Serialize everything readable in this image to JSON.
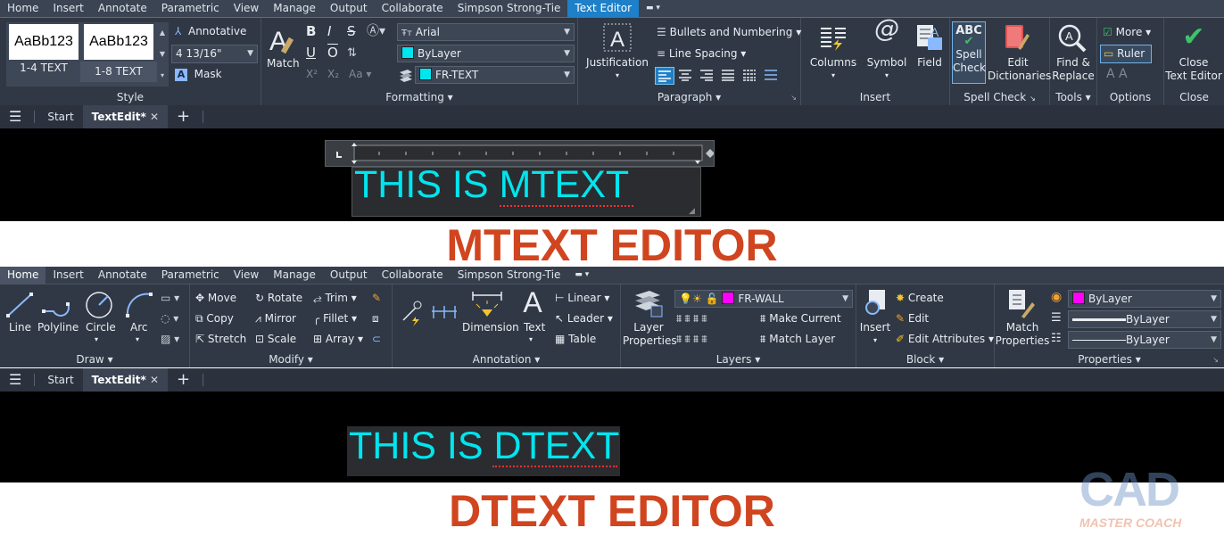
{
  "top": {
    "menu": [
      "Home",
      "Insert",
      "Annotate",
      "Parametric",
      "View",
      "Manage",
      "Output",
      "Collaborate",
      "Simpson Strong-Tie",
      "Text Editor"
    ],
    "style_panel": {
      "samples": [
        {
          "preview": "AaBb123",
          "name": "1-4 TEXT"
        },
        {
          "preview": "AaBb123",
          "name": "1-8 TEXT"
        }
      ],
      "annotative": "Annotative",
      "height": "4 13/16\"",
      "mask": "Mask",
      "label": "Style"
    },
    "formatting": {
      "match": "Match",
      "bold": "B",
      "italic": "I",
      "overline": "O",
      "underline": "U",
      "strike": "S",
      "font": "Arial",
      "color": "ByLayer",
      "layer": "FR-TEXT",
      "label": "Formatting"
    },
    "paragraph": {
      "justification": "Justification",
      "bullets": "Bullets and Numbering",
      "line_spacing": "Line Spacing",
      "label": "Paragraph"
    },
    "insert": {
      "columns": "Columns",
      "symbol": "Symbol",
      "field": "Field",
      "label": "Insert"
    },
    "spell": {
      "spell_check_1": "Spell",
      "spell_check_2": "Check",
      "edit_dict_1": "Edit",
      "edit_dict_2": "Dictionaries",
      "label": "Spell Check",
      "abc": "ABC"
    },
    "tools": {
      "find_1": "Find &",
      "find_2": "Replace",
      "label": "Tools"
    },
    "options": {
      "more": "More",
      "ruler": "Ruler",
      "label": "Options"
    },
    "close": {
      "close_1": "Close",
      "close_2": "Text Editor",
      "label": "Close"
    },
    "tabs": {
      "start": "Start",
      "file": "TextEdit*"
    },
    "text": "THIS IS MTEXT"
  },
  "banner_top": "MTEXT EDITOR",
  "bottom": {
    "menu": [
      "Home",
      "Insert",
      "Annotate",
      "Parametric",
      "View",
      "Manage",
      "Output",
      "Collaborate",
      "Simpson Strong-Tie"
    ],
    "draw": {
      "line": "Line",
      "polyline": "Polyline",
      "circle": "Circle",
      "arc": "Arc",
      "label": "Draw"
    },
    "modify": {
      "move": "Move",
      "rotate": "Rotate",
      "trim": "Trim",
      "copy": "Copy",
      "mirror": "Mirror",
      "fillet": "Fillet",
      "stretch": "Stretch",
      "scale": "Scale",
      "array": "Array",
      "label": "Modify"
    },
    "annotation": {
      "dimension": "Dimension",
      "text": "Text",
      "linear": "Linear",
      "leader": "Leader",
      "table": "Table",
      "label": "Annotation"
    },
    "layers": {
      "props_1": "Layer",
      "props_2": "Properties",
      "layer": "FR-WALL",
      "make_current": "Make Current",
      "match_layer": "Match Layer",
      "label": "Layers"
    },
    "block": {
      "insert": "Insert",
      "create": "Create",
      "edit": "Edit",
      "edit_attr": "Edit Attributes",
      "label": "Block"
    },
    "properties": {
      "match_1": "Match",
      "match_2": "Properties",
      "color": "ByLayer",
      "linetype": "ByLayer",
      "lineweight": "ByLayer",
      "label": "Properties"
    },
    "tabs": {
      "start": "Start",
      "file": "TextEdit*"
    },
    "text": "THIS IS DTEXT"
  },
  "banner_bottom": "DTEXT EDITOR",
  "watermark": {
    "big": "CAD",
    "small": "MASTER COACH"
  },
  "colors": {
    "accent": "#1e80c8",
    "cyan": "#00e5ee",
    "orange": "#d0451f",
    "magenta": "#ff00ff"
  }
}
